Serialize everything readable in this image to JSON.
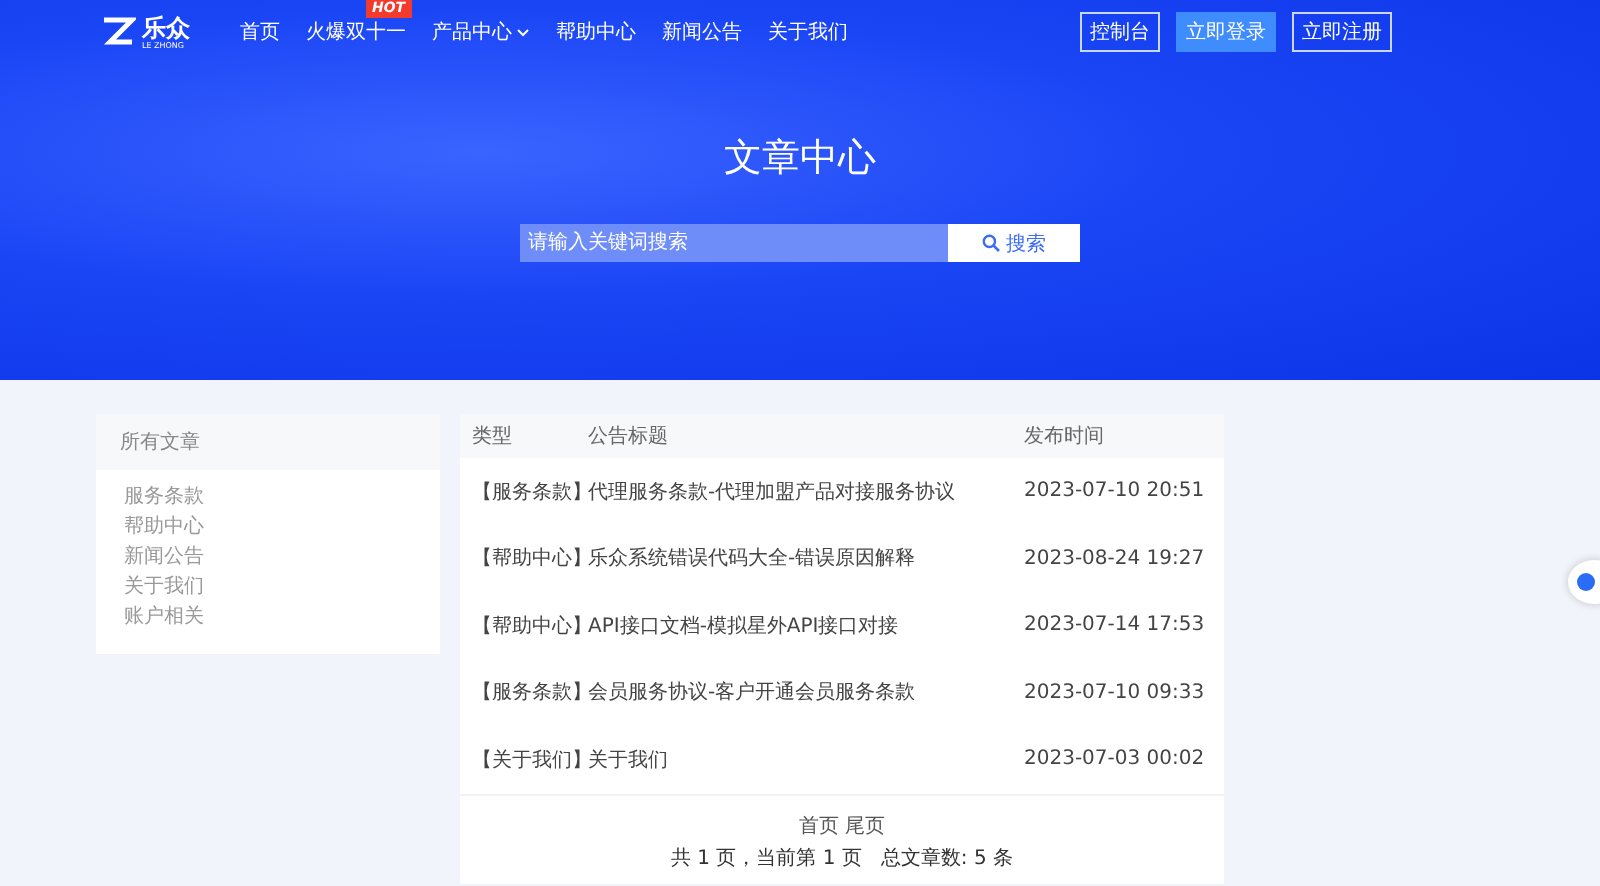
{
  "header": {
    "logo": {
      "name": "乐众",
      "subtitle": "LE ZHONG"
    },
    "nav": [
      {
        "label": "首页",
        "dropdown": false
      },
      {
        "label": "火爆双十一",
        "badge": "HOT",
        "dropdown": false
      },
      {
        "label": "产品中心",
        "dropdown": true
      },
      {
        "label": "帮助中心",
        "dropdown": false
      },
      {
        "label": "新闻公告",
        "dropdown": false
      },
      {
        "label": "关于我们",
        "dropdown": false
      }
    ],
    "buttons": [
      {
        "label": "控制台",
        "kind": "outline"
      },
      {
        "label": "立即登录",
        "kind": "filled"
      },
      {
        "label": "立即注册",
        "kind": "outline"
      }
    ]
  },
  "hero": {
    "title": "文章中心",
    "search": {
      "placeholder": "请输入关键词搜索",
      "button": "搜索"
    }
  },
  "sidebar": {
    "title": "所有文章",
    "items": [
      "服务条款",
      "帮助中心",
      "新闻公告",
      "关于我们",
      "账户相关"
    ]
  },
  "table": {
    "columns": [
      "类型",
      "公告标题",
      "发布时间"
    ],
    "rows": [
      [
        "【服务条款】",
        "代理服务条款-代理加盟产品对接服务协议",
        "2023-07-10 20:51"
      ],
      [
        "【帮助中心】",
        "乐众系统错误代码大全-错误原因解释",
        "2023-08-24 19:27"
      ],
      [
        "【帮助中心】",
        "API接口文档-模拟星外API接口对接",
        "2023-07-14 17:53"
      ],
      [
        "【服务条款】",
        "会员服务协议-客户开通会员服务条款",
        "2023-07-10 09:33"
      ],
      [
        "【关于我们】",
        "关于我们",
        "2023-07-03 00:02"
      ]
    ]
  },
  "pagination": {
    "links": [
      "首页",
      "尾页"
    ],
    "summary": "共 1 页，当前第 1 页   总文章数: 5 条"
  }
}
